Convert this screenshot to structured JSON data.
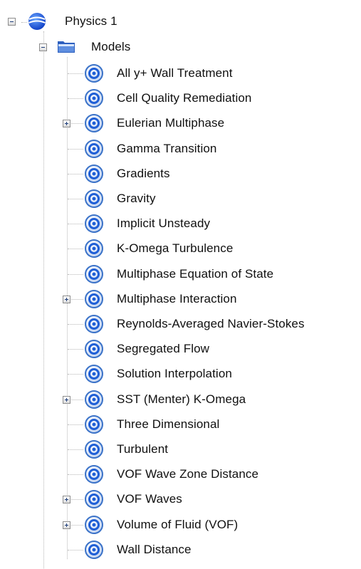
{
  "root": {
    "label": "Physics 1",
    "icon": "physics-continuum-icon",
    "expanded": true
  },
  "models": {
    "label": "Models",
    "icon": "folder-icon",
    "expanded": true,
    "items": [
      {
        "label": "All y+ Wall Treatment",
        "expandable": false
      },
      {
        "label": "Cell Quality Remediation",
        "expandable": false
      },
      {
        "label": "Eulerian Multiphase",
        "expandable": true
      },
      {
        "label": "Gamma Transition",
        "expandable": false
      },
      {
        "label": "Gradients",
        "expandable": false
      },
      {
        "label": "Gravity",
        "expandable": false
      },
      {
        "label": "Implicit Unsteady",
        "expandable": false
      },
      {
        "label": "K-Omega Turbulence",
        "expandable": false
      },
      {
        "label": "Multiphase Equation of State",
        "expandable": false
      },
      {
        "label": "Multiphase Interaction",
        "expandable": true
      },
      {
        "label": "Reynolds-Averaged Navier-Stokes",
        "expandable": false
      },
      {
        "label": "Segregated Flow",
        "expandable": false
      },
      {
        "label": "Solution Interpolation",
        "expandable": false
      },
      {
        "label": "SST (Menter) K-Omega",
        "expandable": true
      },
      {
        "label": "Three Dimensional",
        "expandable": false
      },
      {
        "label": "Turbulent",
        "expandable": false
      },
      {
        "label": "VOF Wave Zone Distance",
        "expandable": false
      },
      {
        "label": "VOF Waves",
        "expandable": true
      },
      {
        "label": "Volume of Fluid (VOF)",
        "expandable": true
      },
      {
        "label": "Wall Distance",
        "expandable": false
      }
    ]
  },
  "colors": {
    "accent_blue": "#1f5fd6",
    "icon_ring": "#3a72c8",
    "connector": "#b7b7b7"
  }
}
